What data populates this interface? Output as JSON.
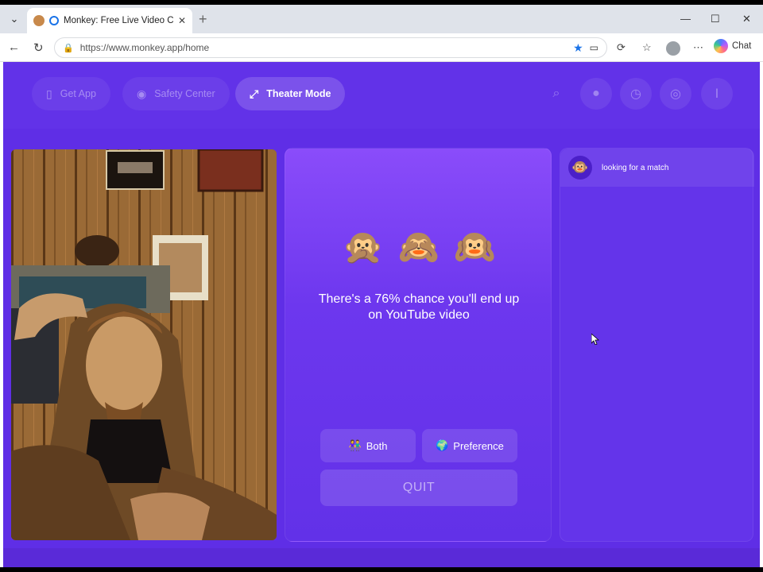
{
  "browser": {
    "tab_title": "Monkey: Free Live Video Chat",
    "url": "https://www.monkey.app/home",
    "copilot_label": "Chat",
    "tab_close": "✕",
    "new_tab": "+"
  },
  "nav": {
    "get_app": "Get App",
    "safety_center": "Safety Center",
    "theater_mode": "Theater Mode"
  },
  "center": {
    "monkeys": [
      "🙊",
      "🙈",
      "🙉"
    ],
    "message": "There's a 76% chance you'll end up on YouTube video",
    "both_label": "Both",
    "both_icon": "👫",
    "preference_label": "Preference",
    "preference_icon": "🌍",
    "quit_label": "QUIT"
  },
  "chat": {
    "status_text": "looking for a match",
    "status_icon": "🐵"
  },
  "colors": {
    "app_bg": "#5f2ee6",
    "panel_gradient_top": "#8a4cfa",
    "accent_blue": "#1a73e8"
  }
}
